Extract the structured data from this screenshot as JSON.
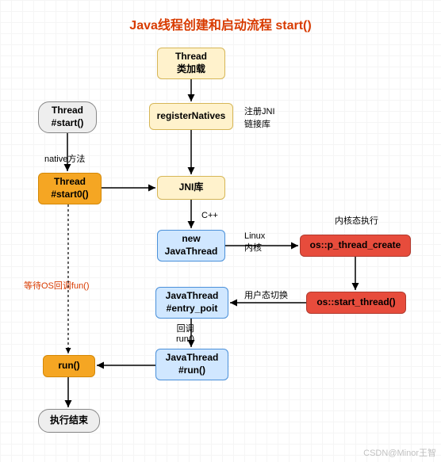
{
  "title": "Java线程创建和启动流程 start()",
  "nodes": {
    "thread_class_load": {
      "line1": "Thread",
      "line2": "类加载"
    },
    "register_natives": {
      "line1": "registerNatives"
    },
    "thread_start": {
      "line1": "Thread",
      "line2": "#start()"
    },
    "thread_start0": {
      "line1": "Thread",
      "line2": "#start0()"
    },
    "jni_lib": {
      "line1": "JNI库"
    },
    "new_javathread": {
      "line1": "new",
      "line2": "JavaThread"
    },
    "os_create": {
      "line1": "os::p_thread_create"
    },
    "os_start": {
      "line1": "os::start_thread()"
    },
    "jt_entry": {
      "line1": "JavaThread",
      "line2": "#entry_poit"
    },
    "jt_run": {
      "line1": "JavaThread",
      "line2": "#run()"
    },
    "run": {
      "line1": "run()"
    },
    "end": {
      "line1": "执行结束"
    }
  },
  "labels": {
    "reg_jni": {
      "l1": "注册JNI",
      "l2": "链接库"
    },
    "native_method": "native方法",
    "cpp": "C++",
    "linux_kernel": {
      "l1": "Linux",
      "l2": "内核"
    },
    "kernel_exec": "内核态执行",
    "user_switch": "用户态切换",
    "callback": {
      "l1": "回调",
      "l2": "run()"
    },
    "wait_os": "等待OS回调fun()"
  },
  "watermark": "CSDN@Minor王智"
}
